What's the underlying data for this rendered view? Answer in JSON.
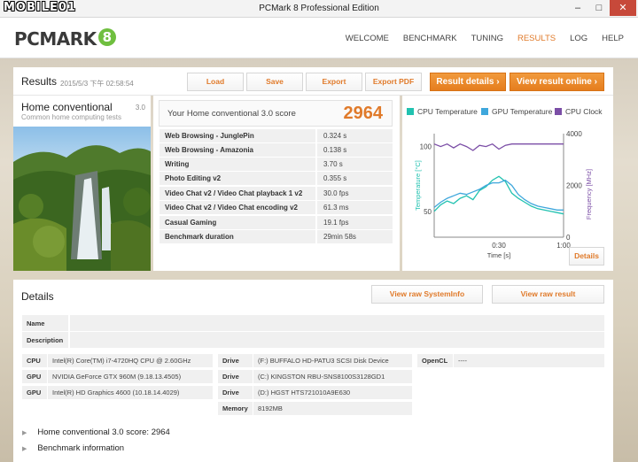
{
  "window": {
    "title": "PCMark 8 Professional Edition",
    "watermark": "MOBILE01",
    "min": "–",
    "max": "□",
    "close": "✕"
  },
  "header": {
    "logo_text": "PCMARK",
    "logo_badge": "8",
    "nav": [
      "WELCOME",
      "BENCHMARK",
      "TUNING",
      "RESULTS",
      "LOG",
      "HELP"
    ],
    "active_nav": "RESULTS"
  },
  "results": {
    "title": "Results",
    "date": "2015/5/3 下午 02:58:54",
    "buttons": {
      "load": "Load",
      "save": "Save",
      "export": "Export",
      "export_pdf": "Export PDF",
      "result_details": "Result details",
      "view_online": "View result online"
    }
  },
  "test": {
    "name": "Home conventional",
    "version": "3.0",
    "subtitle": "Common home computing tests"
  },
  "score": {
    "label": "Your Home conventional 3.0 score",
    "value": "2964",
    "rows": [
      {
        "name": "Web Browsing - JunglePin",
        "value": "0.324 s"
      },
      {
        "name": "Web Browsing - Amazonia",
        "value": "0.138 s"
      },
      {
        "name": "Writing",
        "value": "3.70 s"
      },
      {
        "name": "Photo Editing v2",
        "value": "0.355 s"
      },
      {
        "name": "Video Chat v2 / Video Chat playback 1 v2",
        "value": "30.0 fps"
      },
      {
        "name": "Video Chat v2 / Video Chat encoding v2",
        "value": "61.3 ms"
      },
      {
        "name": "Casual Gaming",
        "value": "19.1 fps"
      },
      {
        "name": "Benchmark duration",
        "value": "29min 58s"
      }
    ]
  },
  "chart": {
    "legend": [
      "CPU Temperature",
      "GPU Temperature",
      "CPU Clock"
    ],
    "left_ticks": [
      "100",
      "50"
    ],
    "right_ticks": [
      "4000",
      "2000",
      "0"
    ],
    "x_ticks": [
      "0:30",
      "1:00"
    ],
    "xlabel": "Time [s]",
    "ylabel_left": "Temperature [°C]",
    "ylabel_right": "Frequency [MHz]",
    "details_button": "Details"
  },
  "chart_data": {
    "type": "line",
    "xlabel": "Time [s]",
    "ylabel": "Temperature [°C]",
    "y2label": "Frequency [MHz]",
    "ylim": [
      30,
      110
    ],
    "y2lim": [
      0,
      4000
    ],
    "series": [
      {
        "name": "CPU Temperature",
        "color": "#21c2b0",
        "axis": "left",
        "x": [
          0,
          3,
          6,
          9,
          12,
          15,
          18,
          21,
          24,
          27,
          30,
          33,
          36,
          39,
          42,
          45,
          48,
          51,
          54,
          57,
          60
        ],
        "y": [
          50,
          55,
          58,
          56,
          60,
          62,
          59,
          66,
          69,
          74,
          77,
          73,
          64,
          60,
          57,
          54,
          52,
          51,
          50,
          49,
          48
        ]
      },
      {
        "name": "GPU Temperature",
        "color": "#3fa7dc",
        "axis": "left",
        "x": [
          0,
          3,
          6,
          9,
          12,
          15,
          18,
          21,
          24,
          27,
          30,
          33,
          36,
          39,
          42,
          45,
          48,
          51,
          54,
          57,
          60
        ],
        "y": [
          53,
          57,
          60,
          62,
          64,
          63,
          65,
          67,
          70,
          72,
          72,
          74,
          70,
          63,
          59,
          56,
          54,
          53,
          52,
          51,
          51
        ]
      },
      {
        "name": "CPU Clock",
        "color": "#7b4ea6",
        "axis": "right",
        "x": [
          0,
          3,
          6,
          9,
          12,
          15,
          18,
          21,
          24,
          27,
          30,
          33,
          36,
          39,
          42,
          45,
          48,
          51,
          54,
          57,
          60
        ],
        "y": [
          3600,
          3500,
          3600,
          3450,
          3600,
          3500,
          3350,
          3550,
          3500,
          3600,
          3400,
          3550,
          3600,
          3600,
          3600,
          3600,
          3600,
          3600,
          3600,
          3600,
          3600
        ]
      }
    ]
  },
  "details": {
    "title": "Details",
    "btn_sysinfo": "View raw SystemInfo",
    "btn_raw": "View raw result",
    "name_label": "Name",
    "name_value": "",
    "desc_label": "Description",
    "desc_value": "",
    "cpu_label": "CPU",
    "cpu_value": "Intel(R) Core(TM) i7-4720HQ CPU @ 2.60GHz",
    "gpu1_label": "GPU",
    "gpu1_value": "NVIDIA GeForce GTX 960M (9.18.13.4505)",
    "gpu2_label": "GPU",
    "gpu2_value": "Intel(R) HD Graphics 4600 (10.18.14.4029)",
    "drive1_label": "Drive",
    "drive1_value": "(F:) BUFFALO HD-PATU3 SCSI Disk Device",
    "drive2_label": "Drive",
    "drive2_value": "(C:) KINGSTON RBU-SNS8100S3128GD1",
    "drive3_label": "Drive",
    "drive3_value": "(D:) HGST HTS721010A9E630",
    "memory_label": "Memory",
    "memory_value": "8192MB",
    "opencl_label": "OpenCL",
    "opencl_value": "----",
    "expand1": "Home conventional 3.0 score: 2964",
    "expand2": "Benchmark information"
  }
}
